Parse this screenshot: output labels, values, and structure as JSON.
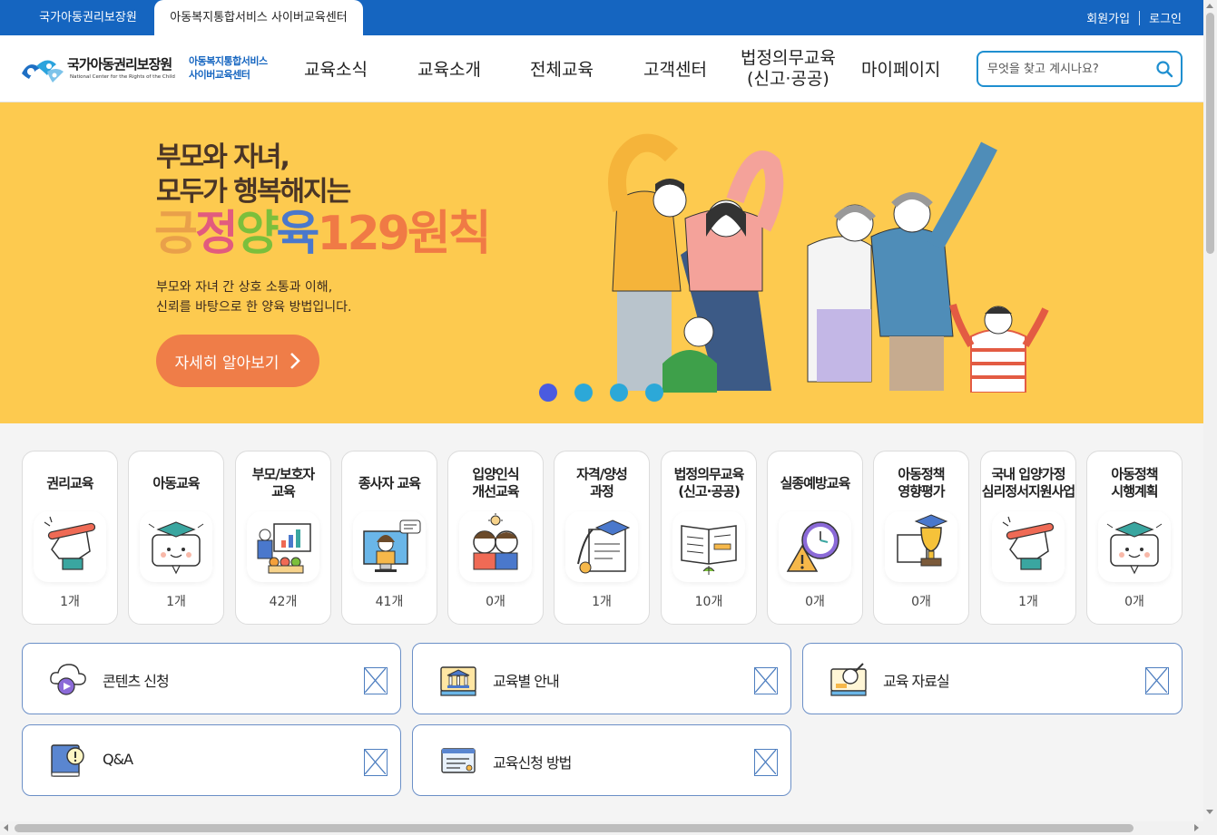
{
  "top_bar": {
    "site_tabs": [
      "국가아동권리보장원",
      "아동복지통합서비스 사이버교육센터"
    ],
    "signup": "회원가입",
    "login": "로그인"
  },
  "header": {
    "logo_kr": "국가아동권리보장원",
    "logo_en": "National Center for the Rights of the Child",
    "logo_sub_1": "아동복지통합서비스",
    "logo_sub_2": "사이버교육센터",
    "nav": [
      "교육소식",
      "교육소개",
      "전체교육",
      "고객센터",
      "법정의무교육",
      "(신고·공공)",
      "마이페이지"
    ],
    "search_placeholder": "무엇을 찾고 계시나요?"
  },
  "banner": {
    "headline_1": "부모와 자녀,",
    "headline_2": "모두가 행복해지는",
    "big_parts": [
      "긍",
      "정",
      "양",
      "육",
      "129원칙"
    ],
    "big_colors": [
      "#e9a04a",
      "#e25b7e",
      "#7bbf3c",
      "#4a78cc",
      "#f07a45"
    ],
    "desc_1": "부모와 자녀 간 상호 소통과 이해,",
    "desc_2": "신뢰를 바탕으로 한 양육 방법입니다.",
    "cta": "자세히 알아보기",
    "slide_count": 4,
    "active_slide": 1
  },
  "categories": [
    {
      "title": "권리교육",
      "count": "1개",
      "icon": "hand-pencil-icon"
    },
    {
      "title": "아동교육",
      "count": "1개",
      "icon": "speech-bubble-graduate-icon"
    },
    {
      "title": "부모/보호자\n교육",
      "count": "42개",
      "icon": "presentation-board-icon"
    },
    {
      "title": "종사자 교육",
      "count": "41개",
      "icon": "online-lecture-icon"
    },
    {
      "title": "입양인식\n개선교육",
      "count": "0개",
      "icon": "children-icon"
    },
    {
      "title": "자격/양성\n과정",
      "count": "1개",
      "icon": "certificate-icon"
    },
    {
      "title": "법정의무교육\n(신고·공공)",
      "count": "10개",
      "icon": "open-book-icon"
    },
    {
      "title": "실종예방교육",
      "count": "0개",
      "icon": "warning-clock-icon"
    },
    {
      "title": "아동정책\n영향평가",
      "count": "0개",
      "icon": "trophy-icon"
    },
    {
      "title": "국내 입양가정\n심리정서지원사업",
      "count": "1개",
      "icon": "hand-pencil-icon"
    },
    {
      "title": "아동정책\n시행계획",
      "count": "0개",
      "icon": "speech-bubble-graduate-icon"
    }
  ],
  "quick_links": [
    {
      "label": "콘텐츠 신청",
      "icon": "cloud-play-icon"
    },
    {
      "label": "교육별 안내",
      "icon": "building-monitor-icon"
    },
    {
      "label": "교육 자료실",
      "icon": "search-monitor-icon"
    },
    {
      "label": "Q&A",
      "icon": "book-exclamation-icon"
    },
    {
      "label": "교육신청 방법",
      "icon": "form-card-icon"
    }
  ],
  "colors": {
    "top_bar": "#1565c0",
    "banner_bg": "#fdca4f",
    "cta_bg": "#ef7d48",
    "dot": "#2ca8d8",
    "dot_active": "#4a5be0",
    "search_border": "#1f8fd0"
  }
}
